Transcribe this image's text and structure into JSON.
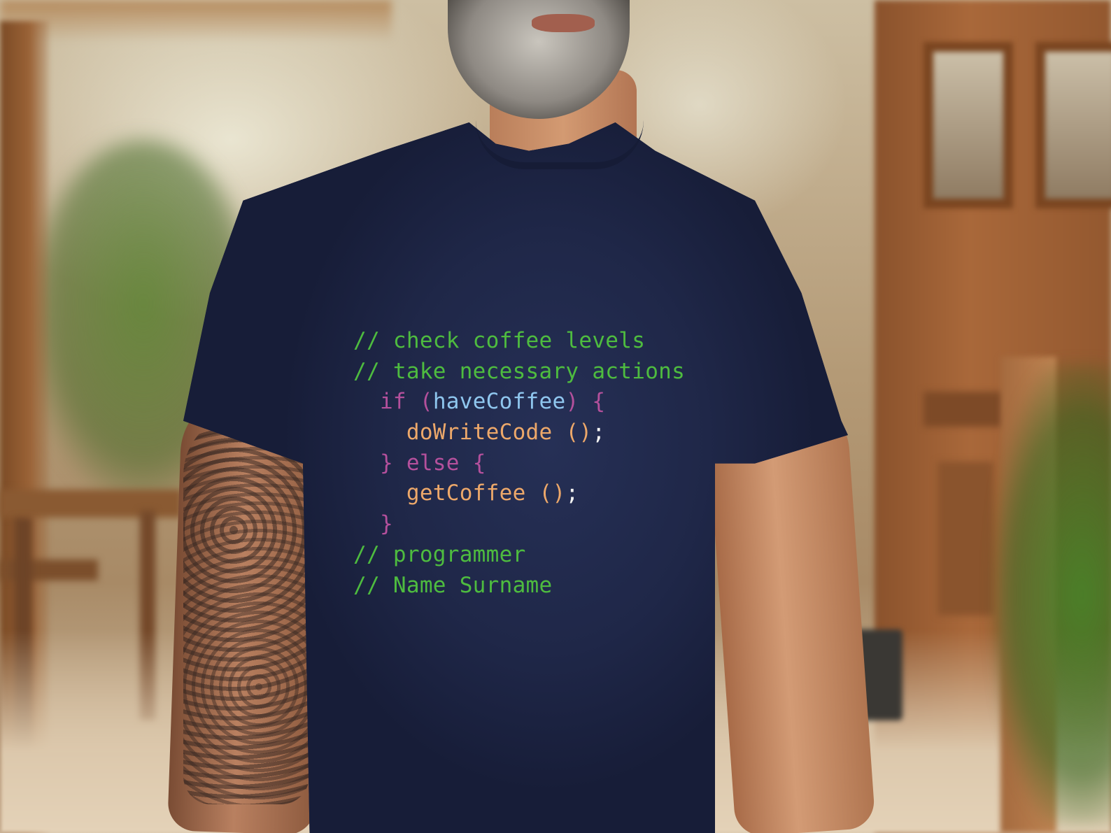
{
  "shirt_print": {
    "lines": [
      {
        "indent": "",
        "parts": [
          {
            "text": "// check coffee levels",
            "kind": "comment"
          }
        ]
      },
      {
        "indent": "",
        "parts": [
          {
            "text": "// take necessary actions",
            "kind": "comment"
          }
        ]
      },
      {
        "indent": "  ",
        "parts": [
          {
            "text": "if",
            "kind": "keyword"
          },
          {
            "text": " ",
            "kind": "space"
          },
          {
            "text": "(",
            "kind": "keyword"
          },
          {
            "text": "haveCoffee",
            "kind": "variable"
          },
          {
            "text": ")",
            "kind": "keyword"
          },
          {
            "text": " ",
            "kind": "space"
          },
          {
            "text": "{",
            "kind": "keyword"
          }
        ]
      },
      {
        "indent": "    ",
        "parts": [
          {
            "text": "doWriteCode",
            "kind": "function"
          },
          {
            "text": " ",
            "kind": "space"
          },
          {
            "text": "()",
            "kind": "function"
          },
          {
            "text": ";",
            "kind": "punct"
          }
        ]
      },
      {
        "indent": "  ",
        "parts": [
          {
            "text": "}",
            "kind": "keyword"
          },
          {
            "text": " ",
            "kind": "space"
          },
          {
            "text": "else",
            "kind": "keyword"
          },
          {
            "text": " ",
            "kind": "space"
          },
          {
            "text": "{",
            "kind": "keyword"
          }
        ]
      },
      {
        "indent": "    ",
        "parts": [
          {
            "text": "getCoffee",
            "kind": "function"
          },
          {
            "text": " ",
            "kind": "space"
          },
          {
            "text": "()",
            "kind": "function"
          },
          {
            "text": ";",
            "kind": "punct"
          }
        ]
      },
      {
        "indent": "  ",
        "parts": [
          {
            "text": "}",
            "kind": "keyword"
          }
        ]
      },
      {
        "indent": "",
        "parts": [
          {
            "text": "// programmer",
            "kind": "comment"
          }
        ]
      },
      {
        "indent": "",
        "parts": [
          {
            "text": "// Name Surname",
            "kind": "comment"
          }
        ]
      }
    ]
  },
  "colors": {
    "shirt": "#1f2748",
    "comment": "#4ebc3f",
    "keyword": "#b4509c",
    "variable": "#8fc6ee",
    "function": "#eda86a",
    "punct": "#f2f2f2"
  }
}
